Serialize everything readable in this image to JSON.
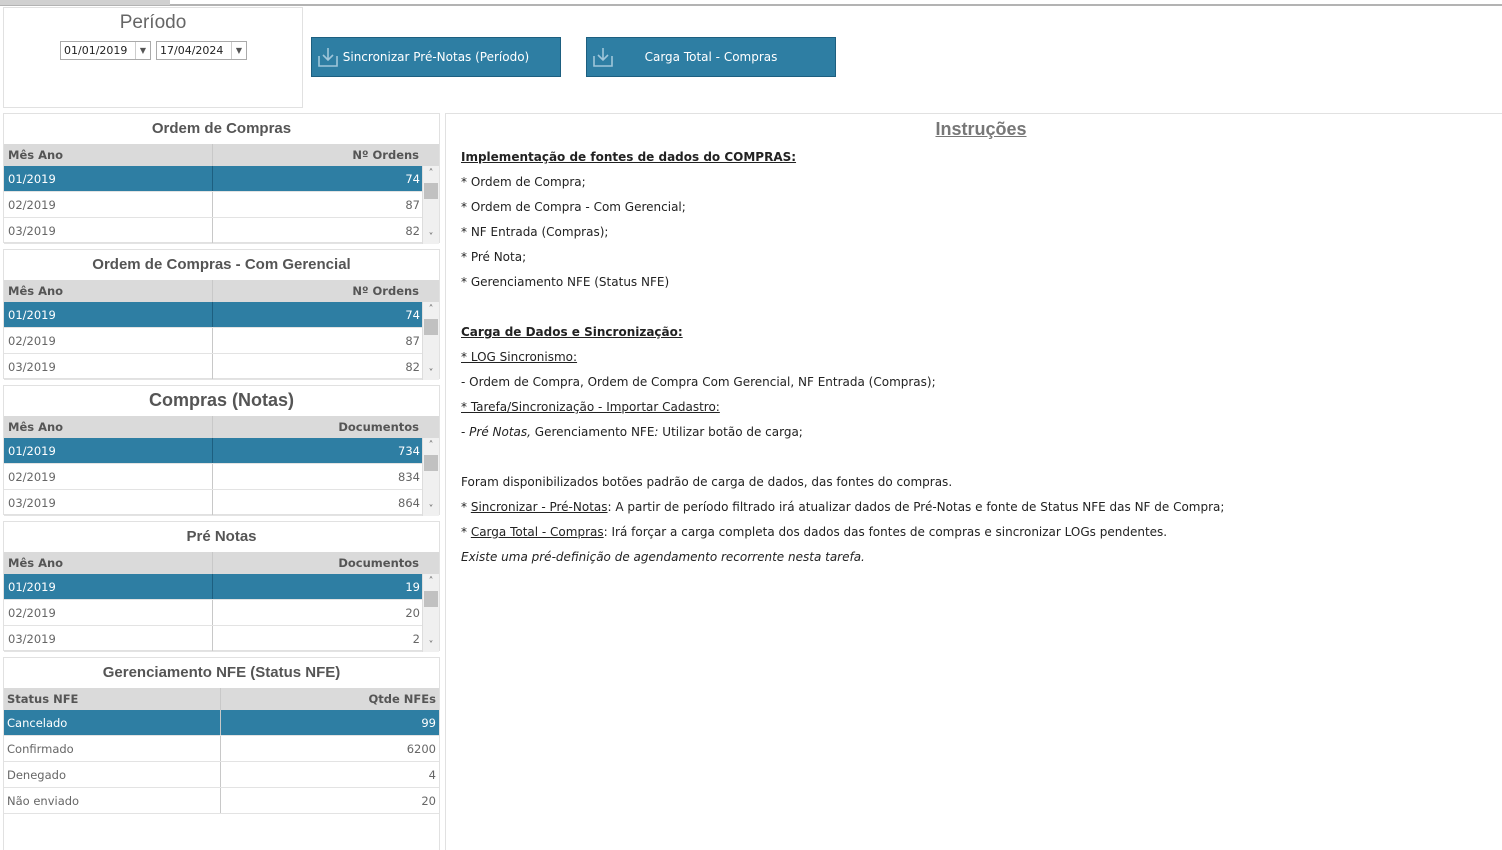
{
  "period": {
    "title": "Período",
    "start_date": "01/01/2019",
    "end_date": "17/04/2024"
  },
  "buttons": {
    "sync_label": "Sincronizar Pré-Notas (Período)",
    "load_label": "Carga Total - Compras",
    "icon": "download-icon"
  },
  "colors": {
    "accent": "#2e7ea3",
    "header_bg": "#dadada"
  },
  "tables": {
    "ordem_compras": {
      "title": "Ordem de Compras",
      "col1": "Mês Ano",
      "col2": "Nº Ordens",
      "rows": [
        {
          "k": "01/2019",
          "v": "74"
        },
        {
          "k": "02/2019",
          "v": "87"
        },
        {
          "k": "03/2019",
          "v": "82"
        }
      ]
    },
    "ordem_gerencial": {
      "title": "Ordem de Compras - Com Gerencial",
      "col1": "Mês Ano",
      "col2": "Nº Ordens",
      "rows": [
        {
          "k": "01/2019",
          "v": "74"
        },
        {
          "k": "02/2019",
          "v": "87"
        },
        {
          "k": "03/2019",
          "v": "82"
        }
      ]
    },
    "compras_notas": {
      "title": "Compras (Notas)",
      "col1": "Mês Ano",
      "col2": "Documentos",
      "rows": [
        {
          "k": "01/2019",
          "v": "734"
        },
        {
          "k": "02/2019",
          "v": "834"
        },
        {
          "k": "03/2019",
          "v": "864"
        }
      ]
    },
    "pre_notas": {
      "title": "Pré Notas",
      "col1": "Mês Ano",
      "col2": "Documentos",
      "rows": [
        {
          "k": "01/2019",
          "v": "19"
        },
        {
          "k": "02/2019",
          "v": "20"
        },
        {
          "k": "03/2019",
          "v": "2"
        }
      ]
    },
    "status_nfe": {
      "title": "Gerenciamento NFE (Status NFE)",
      "col1": "Status NFE",
      "col2": "Qtde NFEs",
      "rows": [
        {
          "k": "Cancelado",
          "v": "99"
        },
        {
          "k": "Confirmado",
          "v": "6200"
        },
        {
          "k": "Denegado",
          "v": "4"
        },
        {
          "k": "Não enviado",
          "v": "20"
        }
      ]
    }
  },
  "instructions": {
    "title": "Instruções",
    "h1": "Implementação  de fontes de dados do COMPRAS:",
    "src1": "* Ordem de Compra;",
    "src2": "* Ordem de Compra - Com Gerencial;",
    "src3": "* NF Entrada (Compras);",
    "src4": "* Pré Nota;",
    "src5": "* Gerenciamento NFE (Status NFE)",
    "h2": "Carga de Dados e Sincronização:",
    "log_title": "* LOG Sincronismo:",
    "log_text": "- Ordem de Compra, Ordem de Compra Com Gerencial, NF Entrada (Compras);",
    "task_title": "* Tarefa/Sincronização - Importar Cadastro:",
    "task_prefix": "- ",
    "task_italic": "Pré Notas,",
    "task_mid": " Gerenciamento NFE",
    "task_italic2": ":",
    "task_end": " Utilizar botão de carga;",
    "avail": "Foram disponibilizados botões padrão de carga de dados, das fontes do compras.",
    "sync_star": "* ",
    "sync_link": "Sincronizar - Pré-Notas",
    "sync_text": ": A partir de período filtrado irá atualizar dados de Pré-Notas e fonte de Status NFE das NF de Compra;",
    "load_star": "* ",
    "load_link": "Carga Total - Compras",
    "load_text": ": Irá forçar a carga completa dos dados das fontes de compras e sincronizar LOGs pendentes.",
    "note": "Existe uma pré-definição de agendamento  recorrente nesta tarefa."
  }
}
